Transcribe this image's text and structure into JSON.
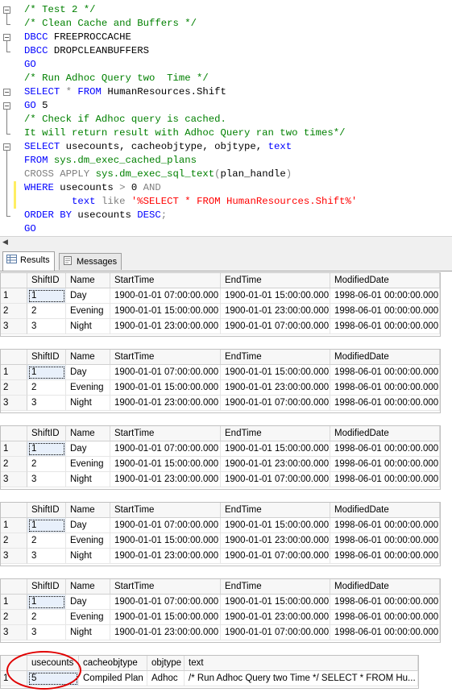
{
  "editor": {
    "lines": [
      [
        {
          "t": "/* Test 2 */",
          "c": "cm"
        }
      ],
      [
        {
          "t": "/* Clean Cache and Buffers */",
          "c": "cm"
        }
      ],
      [
        {
          "t": "DBCC",
          "c": "kw"
        },
        {
          "t": " FREEPROCCACHE",
          "c": ""
        }
      ],
      [
        {
          "t": "DBCC",
          "c": "kw"
        },
        {
          "t": " DROPCLEANBUFFERS",
          "c": ""
        }
      ],
      [
        {
          "t": "GO",
          "c": "kw"
        }
      ],
      [
        {
          "t": "/* Run Adhoc Query two  Time */",
          "c": "cm"
        }
      ],
      [
        {
          "t": "SELECT",
          "c": "kw"
        },
        {
          "t": " * ",
          "c": "gr"
        },
        {
          "t": "FROM",
          "c": "kw"
        },
        {
          "t": " HumanResources.Shift",
          "c": ""
        }
      ],
      [
        {
          "t": "GO",
          "c": "kw"
        },
        {
          "t": " 5",
          "c": ""
        }
      ],
      [
        {
          "t": "/* Check if Adhoc query is cached.",
          "c": "cm"
        }
      ],
      [
        {
          "t": "It will return result with Adhoc Query ran two times*/",
          "c": "cm"
        }
      ],
      [
        {
          "t": "SELECT",
          "c": "kw"
        },
        {
          "t": " usecounts, cacheobjtype, objtype, ",
          "c": ""
        },
        {
          "t": "text",
          "c": "kw"
        }
      ],
      [
        {
          "t": "FROM",
          "c": "kw"
        },
        {
          "t": " sys.dm_exec_cached_plans",
          "c": "sys"
        }
      ],
      [
        {
          "t": "CROSS APPLY",
          "c": "gr"
        },
        {
          "t": " sys.dm_exec_sql_text",
          "c": "sys"
        },
        {
          "t": "(",
          "c": "gr"
        },
        {
          "t": "plan_handle",
          "c": ""
        },
        {
          "t": ")",
          "c": "gr"
        }
      ],
      [
        {
          "t": "WHERE",
          "c": "kw"
        },
        {
          "t": " usecounts ",
          "c": ""
        },
        {
          "t": ">",
          "c": "gr"
        },
        {
          "t": " 0 ",
          "c": ""
        },
        {
          "t": "AND",
          "c": "gr"
        }
      ],
      [
        {
          "t": "        ",
          "c": ""
        },
        {
          "t": "text",
          "c": "kw"
        },
        {
          "t": " ",
          "c": ""
        },
        {
          "t": "like",
          "c": "gr"
        },
        {
          "t": " ",
          "c": ""
        },
        {
          "t": "'%SELECT * FROM HumanResources.Shift%'",
          "c": "st"
        }
      ],
      [
        {
          "t": "ORDER BY",
          "c": "kw"
        },
        {
          "t": " usecounts ",
          "c": ""
        },
        {
          "t": "DESC",
          "c": "kw"
        },
        {
          "t": ";",
          "c": "gr"
        }
      ],
      [
        {
          "t": "GO",
          "c": "kw"
        }
      ]
    ]
  },
  "tabs": {
    "results_label": "Results",
    "messages_label": "Messages",
    "results_icon": "grid-icon",
    "messages_icon": "messages-icon"
  },
  "shift_grid": {
    "columns": [
      "ShiftID",
      "Name",
      "StartTime",
      "EndTime",
      "ModifiedDate"
    ],
    "rows": [
      {
        "num": "1",
        "ShiftID": "1",
        "Name": "Day",
        "StartTime": "1900-01-01 07:00:00.000",
        "EndTime": "1900-01-01 15:00:00.000",
        "ModifiedDate": "1998-06-01 00:00:00.000"
      },
      {
        "num": "2",
        "ShiftID": "2",
        "Name": "Evening",
        "StartTime": "1900-01-01 15:00:00.000",
        "EndTime": "1900-01-01 23:00:00.000",
        "ModifiedDate": "1998-06-01 00:00:00.000"
      },
      {
        "num": "3",
        "ShiftID": "3",
        "Name": "Night",
        "StartTime": "1900-01-01 23:00:00.000",
        "EndTime": "1900-01-01 07:00:00.000",
        "ModifiedDate": "1998-06-01 00:00:00.000"
      }
    ],
    "repeat_count": 5
  },
  "cache_grid": {
    "columns": [
      "usecounts",
      "cacheobjtype",
      "objtype",
      "text"
    ],
    "rows": [
      {
        "num": "1",
        "usecounts": "5",
        "cacheobjtype": "Compiled Plan",
        "objtype": "Adhoc",
        "text": "/* Run Adhoc Query two  Time */  SELECT * FROM Hu..."
      }
    ]
  },
  "colors": {
    "keyword": "#0000ff",
    "comment": "#008000",
    "string": "#ff0000",
    "operator": "#808080",
    "highlight_ellipse": "#e00000",
    "modified_bar": "#ffee62",
    "saved_bar": "#6bbd4c"
  }
}
